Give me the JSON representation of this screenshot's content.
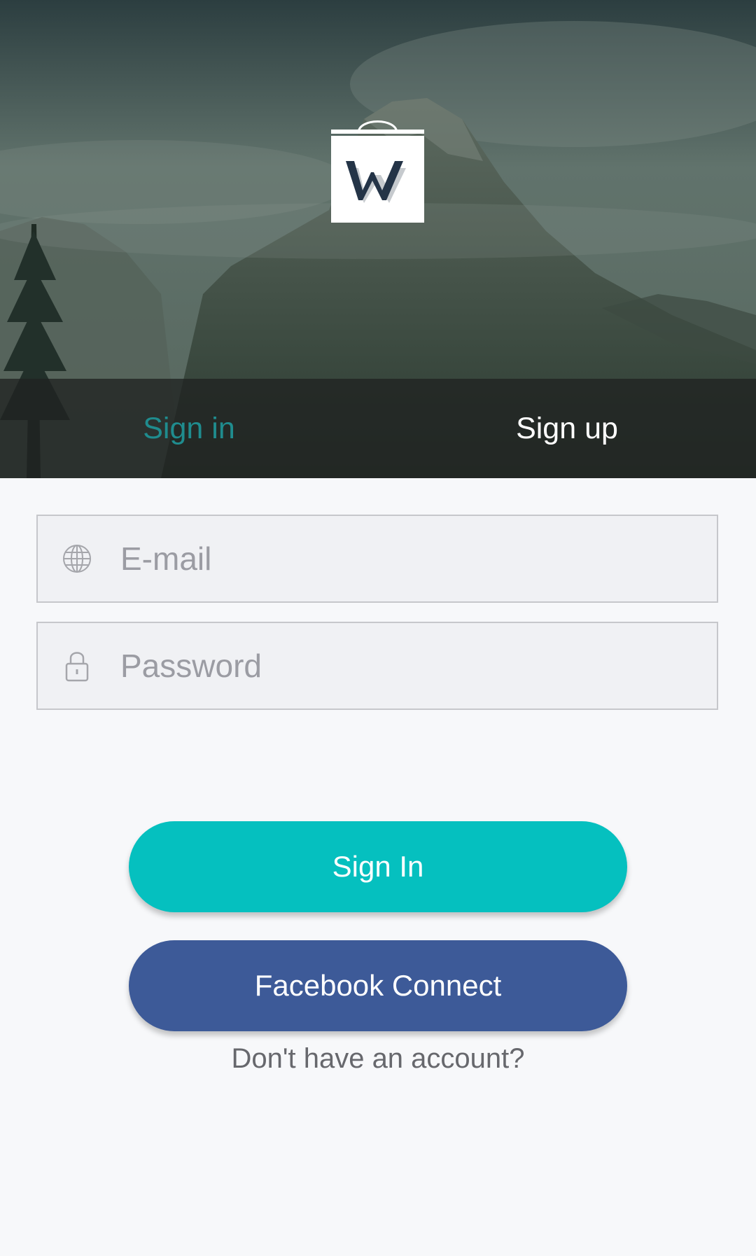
{
  "header": {
    "logo_icon": "shopping-bag-w-logo-icon",
    "tabs": [
      {
        "label": "Sign in",
        "active": true
      },
      {
        "label": "Sign up",
        "active": false
      }
    ]
  },
  "form": {
    "email": {
      "placeholder": "E-mail",
      "value": "",
      "icon": "globe-icon"
    },
    "password": {
      "placeholder": "Password",
      "value": "",
      "icon": "lock-icon"
    }
  },
  "actions": {
    "signin_label": "Sign In",
    "facebook_label": "Facebook Connect",
    "no_account_label": "Don't have an account?"
  },
  "colors": {
    "accent": "#05c0bf",
    "active_tab": "#1f8c8e",
    "facebook": "#3d5a98",
    "background": "#f7f8fa"
  }
}
